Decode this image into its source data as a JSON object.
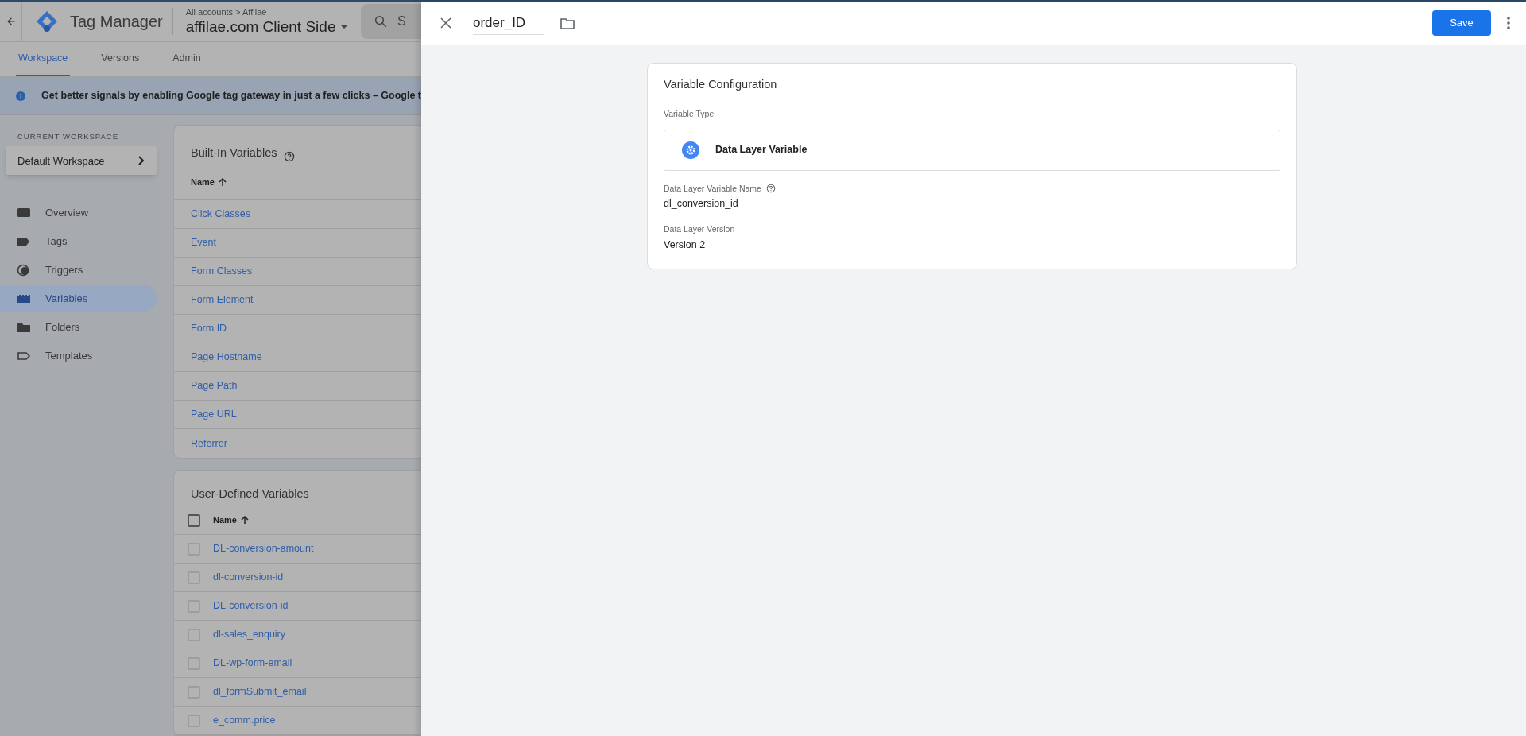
{
  "header": {
    "product": "Tag Manager",
    "breadcrumb": "All accounts > Affilae",
    "container": "affilae.com Client Side",
    "search_placeholder": "S"
  },
  "tabs": [
    {
      "label": "Workspace",
      "selected": true
    },
    {
      "label": "Versions",
      "selected": false
    },
    {
      "label": "Admin",
      "selected": false
    }
  ],
  "banner": {
    "text": "Get better signals by enabling Google tag gateway in just a few clicks – Google t"
  },
  "sidebar": {
    "workspace_label": "CURRENT WORKSPACE",
    "workspace": "Default Workspace",
    "items": [
      {
        "label": "Overview",
        "kind": "overview",
        "selected": false
      },
      {
        "label": "Tags",
        "kind": "tags",
        "selected": false
      },
      {
        "label": "Triggers",
        "kind": "triggers",
        "selected": false
      },
      {
        "label": "Variables",
        "kind": "variables",
        "selected": true
      },
      {
        "label": "Folders",
        "kind": "folders",
        "selected": false
      },
      {
        "label": "Templates",
        "kind": "templates",
        "selected": false
      }
    ]
  },
  "built_in": {
    "title": "Built-In Variables",
    "column": "Name",
    "rows": [
      "Click Classes",
      "Event",
      "Form Classes",
      "Form Element",
      "Form ID",
      "Page Hostname",
      "Page Path",
      "Page URL",
      "Referrer"
    ]
  },
  "user_defined": {
    "title": "User-Defined Variables",
    "column": "Name",
    "select_all_checked": false,
    "rows": [
      {
        "name": "DL-conversion-amount",
        "checked": false
      },
      {
        "name": "dl-conversion-id",
        "checked": false
      },
      {
        "name": "DL-conversion-id",
        "checked": false
      },
      {
        "name": "dl-sales_enquiry",
        "checked": false
      },
      {
        "name": "DL-wp-form-email",
        "checked": false
      },
      {
        "name": "dl_formSubmit_email",
        "checked": false
      },
      {
        "name": "e_comm.price",
        "checked": false
      }
    ]
  },
  "panel": {
    "title": "order_ID",
    "save": "Save",
    "card": {
      "title": "Variable Configuration",
      "type_label": "Variable Type",
      "type": "Data Layer Variable",
      "fields": [
        {
          "label": "Data Layer Variable Name",
          "help": true,
          "value": "dl_conversion_id"
        },
        {
          "label": "Data Layer Version",
          "help": false,
          "value": "Version 2"
        }
      ]
    }
  }
}
